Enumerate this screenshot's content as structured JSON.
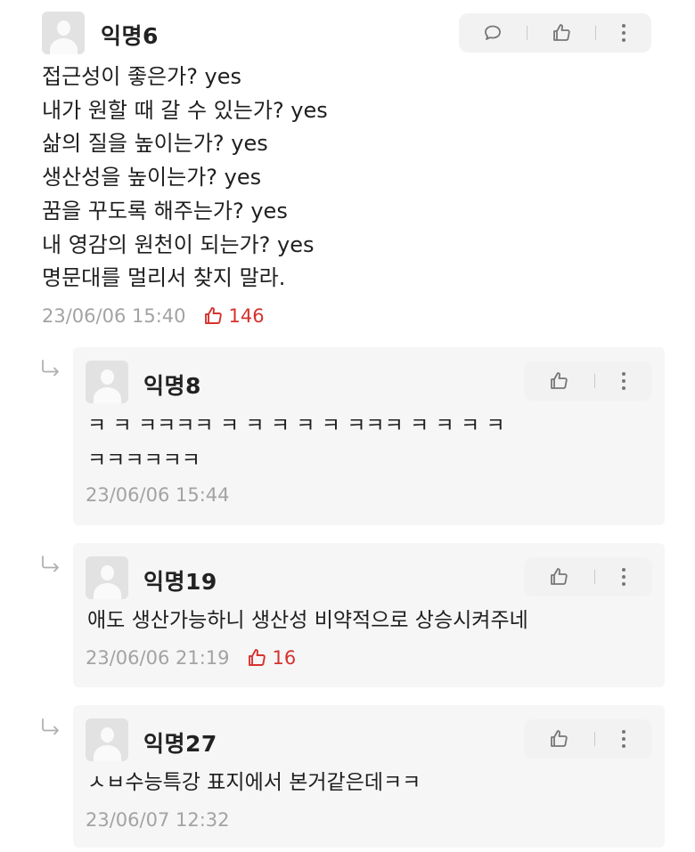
{
  "main_comment": {
    "author": "익명6",
    "lines": [
      "접근성이 좋은가? yes",
      "내가 원할 때 갈 수 있는가? yes",
      "삶의 질을 높이는가? yes",
      "생산성을 높이는가? yes",
      "꿈을 꾸도록 해주는가? yes",
      "내 영감의 원천이 되는가? yes",
      "명문대를 멀리서 찾지 말라."
    ],
    "timestamp": "23/06/06 15:40",
    "likes": "146"
  },
  "replies": [
    {
      "author": "익명8",
      "lines": [
        "ㅋ ㅋ ㅋㅋㅋㅋ ㅋ ㅋ ㅋ ㅋ ㅋ ㅋㅋㅋ ㅋ ㅋ ㅋ ㅋ",
        "ㅋㅋㅋㅋㅋㅋ"
      ],
      "timestamp": "23/06/06 15:44"
    },
    {
      "author": "익명19",
      "lines": [
        "애도 생산가능하니 생산성 비약적으로 상승시켜주네"
      ],
      "timestamp": "23/06/06 21:19",
      "likes": "16"
    },
    {
      "author": "익명27",
      "lines": [
        "ㅅㅂ수능특강 표지에서 본거같은데ㅋㅋ"
      ],
      "timestamp": "23/06/07 12:32"
    }
  ],
  "icons": {
    "reply": "chat-bubble-icon",
    "like": "thumbs-up-icon",
    "more": "more-vertical-icon",
    "reply_indicator": "reply-arrow-icon"
  },
  "colors": {
    "like_accent": "#d6322e",
    "timestamp": "#a3a3a3",
    "card_bg": "#f6f6f6",
    "action_bg": "#f2f2f2"
  }
}
